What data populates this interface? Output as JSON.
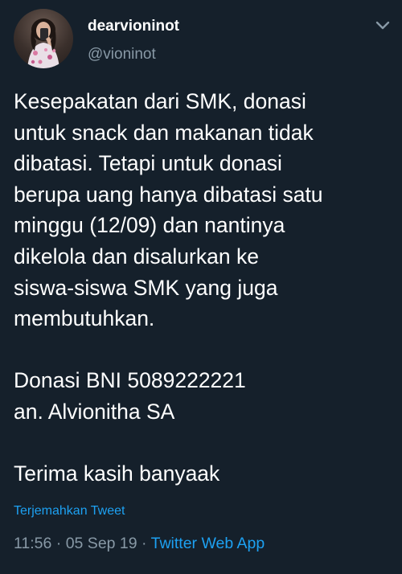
{
  "tweet": {
    "display_name": "dearvioninot",
    "handle": "@vioninot",
    "body": "Kesepakatan dari SMK, donasi\nuntuk snack dan makanan tidak\ndibatasi. Tetapi untuk donasi\nberupa uang hanya dibatasi satu\nminggu (12/09) dan nantinya\ndikelola dan disalurkan ke\nsiswa-siswa SMK yang juga\nmembutuhkan.\n\nDonasi BNI 5089222221\nan. Alvionitha SA\n\nTerima kasih banyaak",
    "translate_label": "Terjemahkan Tweet",
    "time": "11:56",
    "separator": " · ",
    "date": "05 Sep 19",
    "source": "Twitter Web App"
  },
  "icons": {
    "menu": "chevron-down-icon",
    "avatar": "avatar"
  },
  "colors": {
    "background": "#15202b",
    "text": "#ffffff",
    "secondary_text": "#8899a6",
    "link": "#1da1f2"
  }
}
